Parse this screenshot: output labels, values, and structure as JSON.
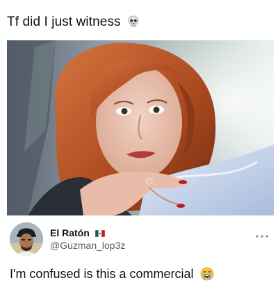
{
  "post": {
    "caption": "Tf did I just witness",
    "caption_emoji": "skull-icon"
  },
  "reply": {
    "display_name": "El Ratón",
    "flag": "mexico-flag-icon",
    "handle": "@Guzman_lop3z",
    "text": "I'm confused is this a commercial",
    "text_emoji": "loudly-crying-face-icon",
    "more_icon": "more-horizontal-icon"
  },
  "colors": {
    "text": "#111111",
    "handle": "#5a5a5a",
    "hair": "#b8552a",
    "sheet": "#c8d6ee"
  }
}
